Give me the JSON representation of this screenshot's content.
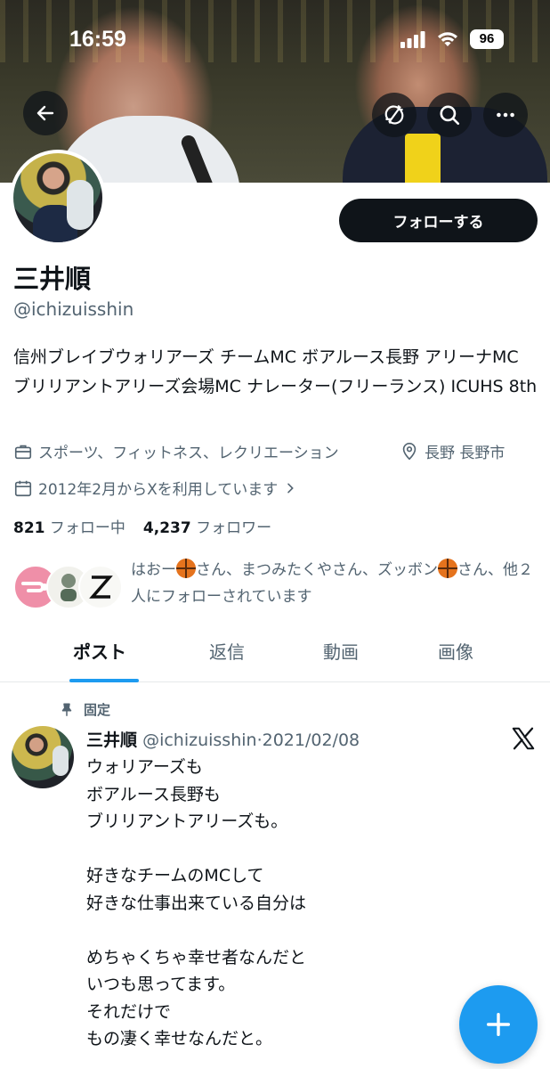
{
  "status": {
    "time": "16:59",
    "battery": "96"
  },
  "profile": {
    "name": "三井順",
    "handle": "@ichizuisshin",
    "follow_label": "フォローする",
    "bio": "信州ブレイブウォリアーズ チームMC ボアルース長野 アリーナMC ブリリアントアリーズ会場MC ナレーター(フリーランス) ICUHS 8th",
    "category": "スポーツ、フィットネス、レクリエーション",
    "location": "長野 長野市",
    "joined": "2012年2月からXを利用しています",
    "following_count": "821",
    "following_label": "フォロー中",
    "followers_count": "4,237",
    "followers_label": "フォロワー"
  },
  "mutuals": {
    "part1": "はおー",
    "part2": "さん、まつみたくやさん、ズッボン",
    "part3": "さん、他２人にフォローされています"
  },
  "tabs": [
    "ポスト",
    "返信",
    "動画",
    "画像"
  ],
  "pinned_post": {
    "pinned_label": "固定",
    "author": "三井順",
    "handle": "@ichizuisshin",
    "separator": "·",
    "date": "2021/02/08",
    "text": "ウォリアーズも\nボアルース長野も\nブリリアントアリーズも。\n\n好きなチームのMCして\n好きな仕事出来ている自分は\n\nめちゃくちゃ幸せ者なんだと\nいつも思ってます。\nそれだけで\nもの凄く幸せなんだと。"
  },
  "colors": {
    "accent": "#1d9bf0",
    "text_primary": "#0f1419",
    "text_secondary": "#536471"
  },
  "icons": [
    "back-arrow-icon",
    "fast-forward-icon",
    "search-icon",
    "more-icon",
    "briefcase-icon",
    "location-pin-icon",
    "calendar-icon",
    "chevron-right-icon",
    "pin-icon",
    "x-logo-icon",
    "plus-icon",
    "basketball-icon",
    "signal-icon",
    "wifi-icon",
    "battery-icon"
  ]
}
